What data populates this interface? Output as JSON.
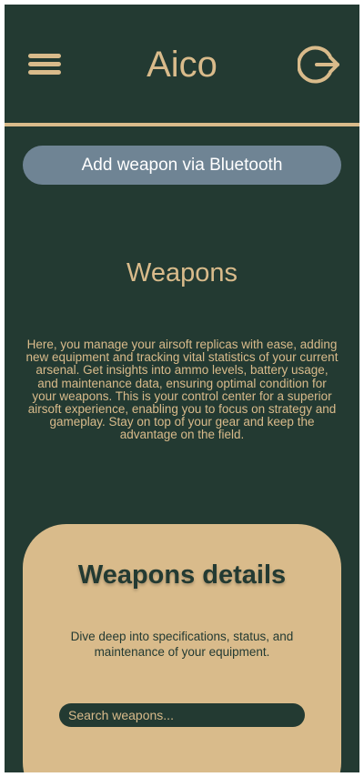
{
  "header": {
    "title": "Aico",
    "menu_icon": "hamburger-menu-icon",
    "logout_icon": "logout-icon"
  },
  "actions": {
    "add_bluetooth_label": "Add weapon via Bluetooth"
  },
  "weapons": {
    "title": "Weapons",
    "description": "Here, you manage your airsoft replicas with ease, adding new equipment and tracking vital statistics of your current arsenal. Get insights into ammo levels, battery usage, and maintenance data, ensuring optimal condition for your weapons. This is your control center for a superior airsoft experience, enabling you to focus on strategy and gameplay. Stay on top of your gear and keep the advantage on the field."
  },
  "details": {
    "title": "Weapons details",
    "description": "Dive deep into specifications, status, and maintenance of your equipment.",
    "search_placeholder": "Search weapons...",
    "search_value": ""
  },
  "colors": {
    "background": "#233a32",
    "accent": "#d9bb8b",
    "button": "#6f8494",
    "button_text": "#ffffff"
  }
}
